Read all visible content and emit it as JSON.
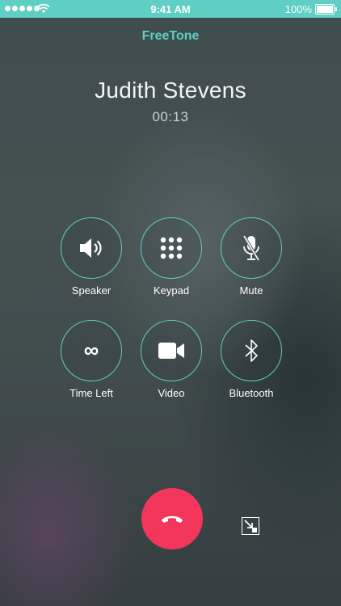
{
  "status_bar": {
    "time": "9:41 AM",
    "battery": "100%"
  },
  "app": {
    "title": "FreeTone"
  },
  "call": {
    "caller_name": "Judith Stevens",
    "duration": "00:13"
  },
  "controls": [
    {
      "label": "Speaker",
      "icon": "speaker-icon"
    },
    {
      "label": "Keypad",
      "icon": "keypad-icon"
    },
    {
      "label": "Mute",
      "icon": "mute-icon"
    },
    {
      "label": "Time Left",
      "icon": "infinity-icon",
      "value": "∞"
    },
    {
      "label": "Video",
      "icon": "video-icon"
    },
    {
      "label": "Bluetooth",
      "icon": "bluetooth-icon"
    }
  ],
  "colors": {
    "accent": "#5ecfc2",
    "end_call": "#f2365c"
  }
}
